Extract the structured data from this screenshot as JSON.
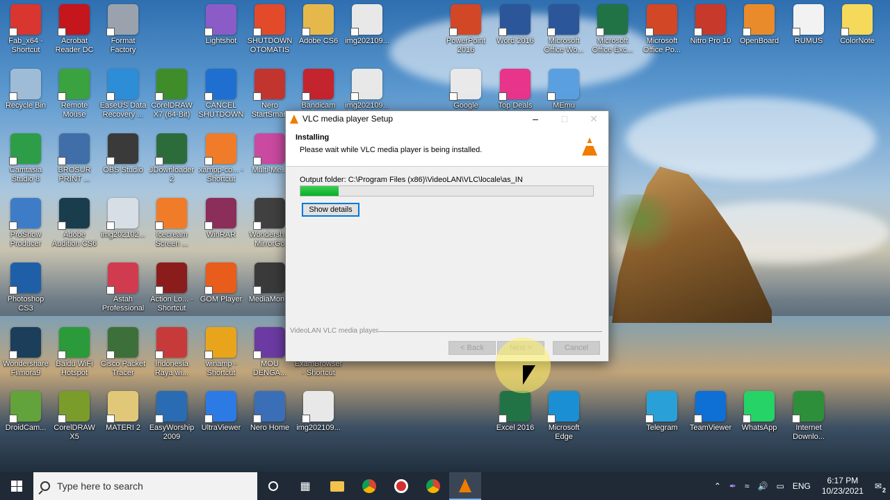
{
  "dialog": {
    "title": "VLC media player Setup",
    "header_title": "Installing",
    "header_subtitle": "Please wait while VLC media player is being installed.",
    "output_folder": "Output folder: C:\\Program Files (x86)\\VideoLAN\\VLC\\locale\\as_IN",
    "progress_fraction": 0.13,
    "show_details": "Show details",
    "branding": "VideoLAN VLC media player",
    "back": "< Back",
    "next": "Next >",
    "cancel": "Cancel"
  },
  "desktop_icons": {
    "c1": [
      "Fab_x64 - Shortcut",
      "Recycle Bin",
      "Camtasia Studio 8",
      "ProShow Producer",
      "Photoshop CS3",
      "Wondershare Filmora9",
      "DroidCam..."
    ],
    "c2": [
      "Acrobat Reader DC",
      "Remote Mouse",
      "BROSUR PRINT ...",
      "Adobe Audition CS6",
      "Baidu WiFi Hotspot",
      "CorelDRAW X5"
    ],
    "c3": [
      "Format Factory",
      "EaseUS Data Recovery ...",
      "OBS Studio",
      "img202102...",
      "Astah Professional",
      "Cisco Packet Tracer",
      "MATERI 2"
    ],
    "c4": [
      "CorelDRAW X7 (64-Bit)",
      "JDownloader 2",
      "Icecream Screen ...",
      "Action Lo... - Shortcut",
      "Indonesia Raya wi...",
      "EasyWorship 2009"
    ],
    "c5": [
      "Lightshot",
      "CANCEL SHUTDOWN",
      "xampp-co... - Shortcut",
      "WinRAR",
      "GOM Player",
      "winamp - Shortcut",
      "UltraViewer"
    ],
    "c6": [
      "SHUTDOWN OTOMATIS",
      "Nero StartSmart",
      "Multi-Me...",
      "Wondersh... MirrorGo",
      "MediaMon...",
      "MOU DENGA...",
      "Nero Home"
    ],
    "c7": [
      "Adobe CS6",
      "Bandicam"
    ],
    "c8": [
      "img202109...",
      "img202109...",
      "ExamBrowser - Shortcut",
      "img202109..."
    ],
    "right_top": [
      "PowerPoint 2016",
      "Word 2016",
      "Microsoft Office Wo...",
      "Microsoft Office Exc...",
      "Microsoft Office Po...",
      "Nitro Pro 10",
      "OpenBoard",
      "RUMUS",
      "ColorNote"
    ],
    "right_second": [
      "Google",
      "Top Deals",
      "MEmu"
    ],
    "bottom_right": [
      "Excel 2016",
      "Microsoft Edge",
      "Telegram",
      "TeamViewer",
      "WhatsApp",
      "Internet Downlo..."
    ]
  },
  "icon_colors": {
    "c1": [
      "#d9362f",
      "#9fbcd6",
      "#2e9d48",
      "#3f7cc8",
      "#1f5fa8",
      "#1b3e5a",
      "#63a33b"
    ],
    "c2": [
      "#c4161c",
      "#3aa23e",
      "#3f6ea8",
      "#1a3d4d",
      "#2b9a3a",
      "#7a9c2b"
    ],
    "c3": [
      "#9aa3ad",
      "#2d8dd6",
      "#3a3a3a",
      "#d8dee6",
      "#d13b4f",
      "#3c6f3a",
      "#e0c878"
    ],
    "c4": [
      "#3f8c2a",
      "#2c6c3b",
      "#f07c2a",
      "#8a1c1c",
      "#c73a3a",
      "#2a6cb3"
    ],
    "c5": [
      "#8b5cc7",
      "#1f6fd1",
      "#f07c2a",
      "#8b2f5a",
      "#e85c1c",
      "#e8a51c",
      "#2c7be5"
    ],
    "c6": [
      "#e24a2a",
      "#c2352f",
      "#c94aa0",
      "#404040",
      "#3a3a3a",
      "#6b3ba3",
      "#3a6fb8"
    ],
    "c7": [
      "#e6b84c",
      "#c4242d"
    ],
    "c8": [
      "#e8e8e8",
      "#e8e8e8",
      "#7a6f3a",
      "#e8e8e8"
    ],
    "right_top": [
      "#d24726",
      "#2b579a",
      "#2b579a",
      "#217346",
      "#d24726",
      "#c7392b",
      "#e98b2a",
      "#f2f2f2",
      "#f5d95a"
    ],
    "right_second": [
      "#e9e9e9",
      "#e8348a",
      "#5aa0e0"
    ],
    "bottom_right": [
      "#217346",
      "#1b8fd3",
      "#2aa0d8",
      "#0e6fd4",
      "#25d366",
      "#2d8f3a"
    ]
  },
  "taskbar": {
    "search_placeholder": "Type here to search",
    "language": "ENG",
    "time": "6:17 PM",
    "date": "10/23/2021",
    "notification_count": "2"
  }
}
